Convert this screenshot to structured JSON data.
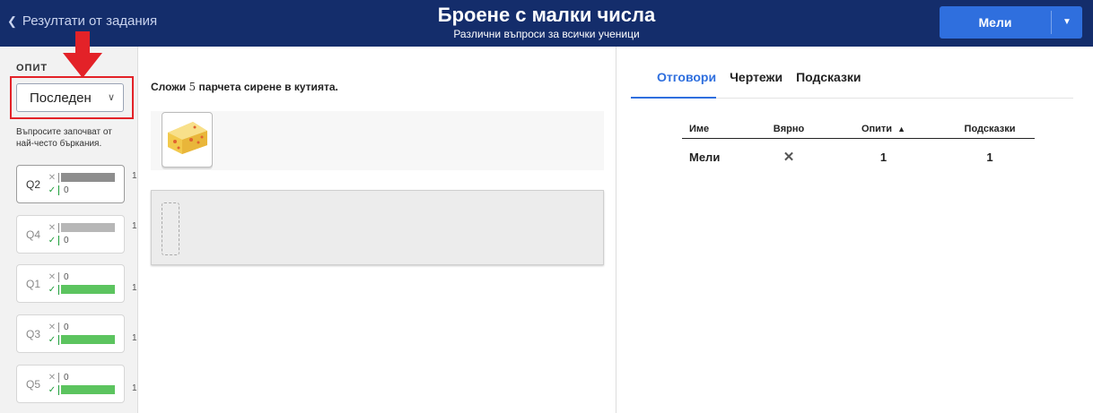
{
  "header": {
    "back_label": "Резултати от задания",
    "title": "Броене с малки числа",
    "subtitle": "Различни въпроси за всички ученици",
    "student_button_label": "Мели"
  },
  "sidebar": {
    "attempt_label": "ОПИТ",
    "attempt_value": "Последен",
    "sort_note": "Въпросите започват от най-често бъркания.",
    "questions": [
      {
        "name": "Q2",
        "wrong": 1,
        "correct": 0
      },
      {
        "name": "Q4",
        "wrong": 1,
        "correct": 0
      },
      {
        "name": "Q1",
        "wrong": 0,
        "correct": 1
      },
      {
        "name": "Q3",
        "wrong": 0,
        "correct": 1
      },
      {
        "name": "Q5",
        "wrong": 0,
        "correct": 1
      }
    ]
  },
  "question": {
    "prompt_pre": "Сложи",
    "prompt_num": "5",
    "prompt_post": "парчета сирене в кутията."
  },
  "right": {
    "tabs": [
      "Отговори",
      "Чертежи",
      "Подсказки"
    ],
    "table": {
      "headers": [
        "Име",
        "Вярно",
        "Опити",
        "Подсказки"
      ],
      "rows": [
        {
          "name": "Мели",
          "correct": "✕",
          "attempts": "1",
          "hints": "1"
        }
      ]
    }
  },
  "colors": {
    "header_bg": "#142d6b",
    "accent": "#2f6fde",
    "correct_green": "#5cc45f",
    "wrong_grey": "#8e8e8e",
    "highlight_red": "#e32228"
  }
}
